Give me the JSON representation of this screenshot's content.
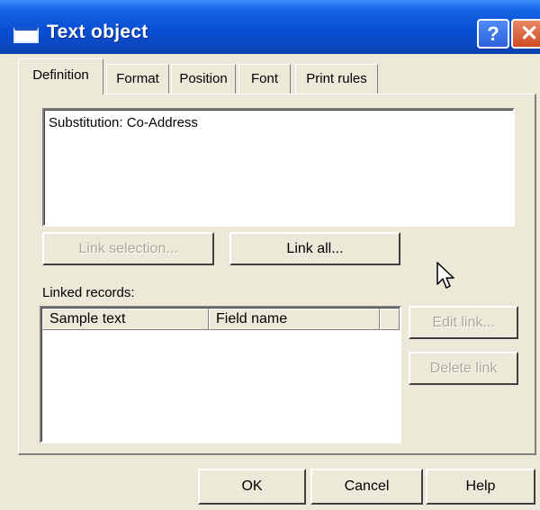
{
  "window": {
    "title": "Text object",
    "help_glyph": "?",
    "close_glyph": "✕"
  },
  "tabs": [
    {
      "label": "Definition",
      "active": true
    },
    {
      "label": "Format",
      "active": false
    },
    {
      "label": "Position",
      "active": false
    },
    {
      "label": "Font",
      "active": false
    },
    {
      "label": "Print rules",
      "active": false
    }
  ],
  "definition": {
    "text": "Substitution: Co-Address",
    "link_selection_label": "Link selection...",
    "link_all_label": "Link all...",
    "linked_records_label": "Linked records:",
    "columns": [
      "Sample text",
      "Field name"
    ],
    "rows": [],
    "edit_link_label": "Edit link...",
    "delete_link_label": "Delete link"
  },
  "footer": {
    "ok_label": "OK",
    "cancel_label": "Cancel",
    "help_label": "Help"
  },
  "colors": {
    "titlebar": "#0a4fd3",
    "dialog_face": "#ece9d8",
    "disabled_text": "#aca899"
  },
  "icons": {
    "window_icon": "window-icon",
    "cursor": "mouse-pointer-icon"
  }
}
